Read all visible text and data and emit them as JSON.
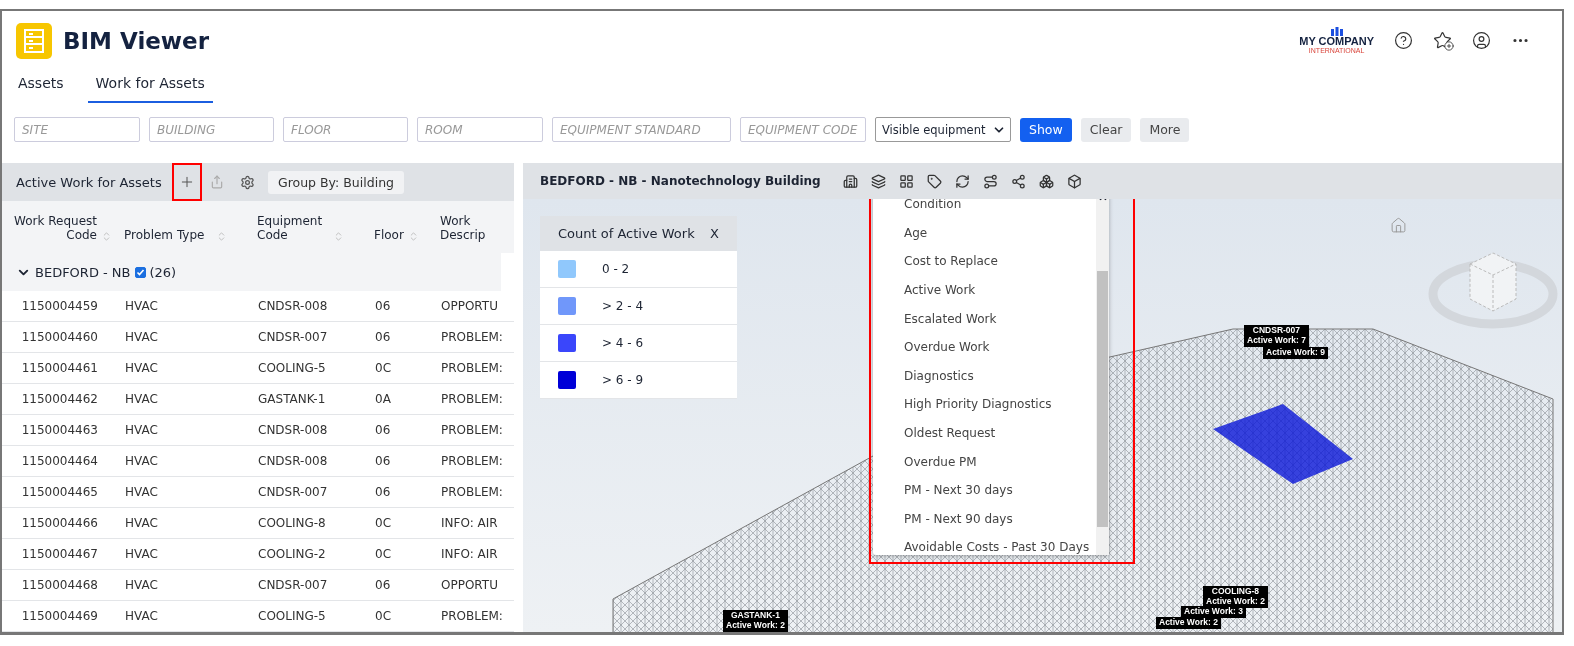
{
  "header": {
    "app_title": "BIM Viewer",
    "company": {
      "name": "MY COMPANY",
      "subtitle": "INTERNATIONAL"
    }
  },
  "tabs": [
    {
      "label": "Assets",
      "selected": false
    },
    {
      "label": "Work for Assets",
      "selected": true
    }
  ],
  "filters": [
    {
      "placeholder": "SITE"
    },
    {
      "placeholder": "BUILDING"
    },
    {
      "placeholder": "FLOOR"
    },
    {
      "placeholder": "ROOM"
    },
    {
      "placeholder": "EQUIPMENT STANDARD"
    },
    {
      "placeholder": "EQUIPMENT CODE"
    }
  ],
  "visibility_select": {
    "value": "Visible equipment"
  },
  "filter_buttons": [
    {
      "label": "Show",
      "kind": "primary"
    },
    {
      "label": "Clear",
      "kind": "secondary"
    },
    {
      "label": "More",
      "kind": "secondary"
    }
  ],
  "left_panel": {
    "title": "Active Work for Assets",
    "add_highlighted": true,
    "group_by": "Group By: Building",
    "columns": [
      {
        "label": "Work Request Code",
        "sortable": true
      },
      {
        "label": "Problem Type",
        "sortable": true
      },
      {
        "label": "Equipment Code",
        "sortable": true
      },
      {
        "label": "Floor",
        "sortable": true
      },
      {
        "label": "Work Descrip",
        "sortable": false
      }
    ],
    "group": {
      "label": "BEDFORD - NB",
      "checked": true,
      "expanded": true,
      "count": "(26)"
    },
    "rows": [
      [
        "1150004459",
        "HVAC",
        "CNDSR-008",
        "06",
        "OPPORTU"
      ],
      [
        "1150004460",
        "HVAC",
        "CNDSR-007",
        "06",
        "PROBLEM:"
      ],
      [
        "1150004461",
        "HVAC",
        "COOLING-5",
        "0C",
        "PROBLEM:"
      ],
      [
        "1150004462",
        "HVAC",
        "GASTANK-1",
        "0A",
        "PROBLEM:"
      ],
      [
        "1150004463",
        "HVAC",
        "CNDSR-008",
        "06",
        "PROBLEM:"
      ],
      [
        "1150004464",
        "HVAC",
        "CNDSR-008",
        "06",
        "PROBLEM:"
      ],
      [
        "1150004465",
        "HVAC",
        "CNDSR-007",
        "06",
        "PROBLEM:"
      ],
      [
        "1150004466",
        "HVAC",
        "COOLING-8",
        "0C",
        "INFO: AIR"
      ],
      [
        "1150004467",
        "HVAC",
        "COOLING-2",
        "0C",
        "INFO: AIR"
      ],
      [
        "1150004468",
        "HVAC",
        "CNDSR-007",
        "06",
        "OPPORTU"
      ],
      [
        "1150004469",
        "HVAC",
        "COOLING-5",
        "0C",
        "PROBLEM:"
      ]
    ]
  },
  "viewer": {
    "title": "BEDFORD - NB - Nanotechnology Building",
    "legend": {
      "title": "Count of Active Work",
      "close": "X",
      "items": [
        {
          "label": "0 - 2",
          "color": "#90c8fc"
        },
        {
          "label": "> 2 - 4",
          "color": "#7097fa"
        },
        {
          "label": "> 4 - 6",
          "color": "#3a46fb"
        },
        {
          "label": "> 6 - 9",
          "color": "#0000d8"
        }
      ]
    },
    "menu": {
      "highlighted": true,
      "items": [
        "Condition",
        "Age",
        "Cost to Replace",
        "Active Work",
        "Escalated Work",
        "Overdue Work",
        "Diagnostics",
        "High Priority Diagnostics",
        "Oldest Request",
        "Overdue PM",
        "PM - Next 30 days",
        "PM - Next 90 days",
        "Avoidable Costs - Past 30 Days"
      ]
    },
    "markers": [
      {
        "lines": [
          "CNDSR-007",
          "Active Work: 7"
        ]
      },
      {
        "lines": [
          "Active Work: 9"
        ]
      },
      {
        "lines": [
          "GASTANK-1",
          "Active Work: 2"
        ]
      },
      {
        "lines": [
          "COOLING-8",
          "Active Work: 2"
        ]
      },
      {
        "lines": [
          "Active Work: 3"
        ]
      },
      {
        "lines": [
          "Active Work: 2"
        ]
      }
    ]
  }
}
